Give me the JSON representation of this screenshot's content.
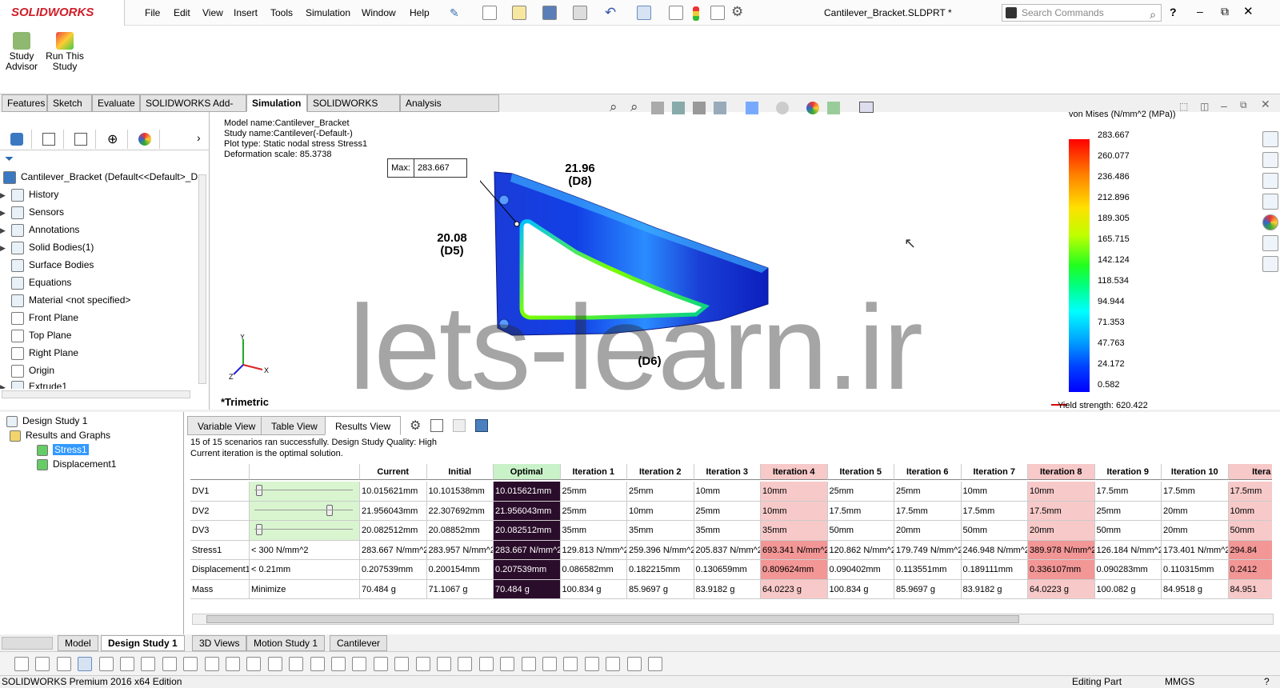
{
  "app": {
    "logo": "SOLIDWORKS",
    "document_title": "Cantilever_Bracket.SLDPRT *"
  },
  "menu": [
    "File",
    "Edit",
    "View",
    "Insert",
    "Tools",
    "Simulation",
    "Window",
    "Help"
  ],
  "search": {
    "placeholder": "Search Commands"
  },
  "command_manager": {
    "study_advisor": "Study Advisor",
    "run_study": "Run This Study"
  },
  "tabs": [
    "Features",
    "Sketch",
    "Evaluate",
    "SOLIDWORKS Add-Ins",
    "Simulation",
    "SOLIDWORKS MBD",
    "Analysis Preparation"
  ],
  "tabs_active": "Simulation",
  "feature_tree": {
    "root": "Cantilever_Bracket  (Default<<Default>_D",
    "items": [
      "History",
      "Sensors",
      "Annotations",
      "Solid Bodies(1)",
      "Surface Bodies",
      "Equations",
      "Material <not specified>",
      "Front Plane",
      "Top Plane",
      "Right Plane",
      "Origin",
      "Extrude1"
    ]
  },
  "plot_info": {
    "model": "Model name:Cantilever_Bracket",
    "study": "Study name:Cantilever(-Default-)",
    "type": "Plot type: Static nodal stress Stress1",
    "scale": "Deformation scale: 85.3738"
  },
  "max_label": {
    "key": "Max:",
    "value": "283.667"
  },
  "dimensions": {
    "d8": "21.96\n(D8)",
    "d5": "20.08\n(D5)",
    "d6": "(D6)"
  },
  "watermark": "lets-learn.ir",
  "view_label": "*Trimetric",
  "legend": {
    "title": "von Mises (N/mm^2 (MPa))",
    "ticks": [
      "283.667",
      "260.077",
      "236.486",
      "212.896",
      "189.305",
      "165.715",
      "142.124",
      "118.534",
      "94.944",
      "71.353",
      "47.763",
      "24.172",
      "0.582"
    ],
    "yield": "Yield strength: 620.422"
  },
  "design_tree": {
    "root": "Design Study 1",
    "group": "Results and Graphs",
    "items": [
      "Stress1",
      "Displacement1"
    ]
  },
  "view_tabs": [
    "Variable View",
    "Table View",
    "Results View"
  ],
  "view_tabs_active": "Results View",
  "ds_message": [
    "15 of 15 scenarios ran successfully. Design Study Quality: High",
    "Current iteration is the optimal solution."
  ],
  "table": {
    "headers": [
      "Current",
      "Initial",
      "Optimal",
      "Iteration 1",
      "Iteration 2",
      "Iteration 3",
      "Iteration 4",
      "Iteration 5",
      "Iteration 6",
      "Iteration 7",
      "Iteration 8",
      "Iteration 9",
      "Iteration 10",
      "Itera"
    ],
    "rows": [
      {
        "name": "DV1",
        "constraint": "",
        "slider": 0.02,
        "values": [
          "10.015621mm",
          "10.101538mm",
          "10.015621mm",
          "25mm",
          "25mm",
          "10mm",
          "10mm",
          "25mm",
          "25mm",
          "10mm",
          "10mm",
          "17.5mm",
          "17.5mm",
          "17.5mm"
        ]
      },
      {
        "name": "DV2",
        "constraint": "",
        "slider": 0.78,
        "values": [
          "21.956043mm",
          "22.307692mm",
          "21.956043mm",
          "25mm",
          "10mm",
          "25mm",
          "10mm",
          "17.5mm",
          "17.5mm",
          "17.5mm",
          "17.5mm",
          "25mm",
          "20mm",
          "10mm"
        ]
      },
      {
        "name": "DV3",
        "constraint": "",
        "slider": 0.02,
        "values": [
          "20.082512mm",
          "20.08852mm",
          "20.082512mm",
          "35mm",
          "35mm",
          "35mm",
          "35mm",
          "50mm",
          "20mm",
          "50mm",
          "20mm",
          "50mm",
          "20mm",
          "50mm"
        ]
      },
      {
        "name": "Stress1",
        "constraint": "< 300 N/mm^2",
        "values": [
          "283.667 N/mm^2",
          "283.957 N/mm^2",
          "283.667 N/mm^2",
          "129.813 N/mm^2",
          "259.396 N/mm^2",
          "205.837 N/mm^2",
          "693.341 N/mm^2",
          "120.862 N/mm^2",
          "179.749 N/mm^2",
          "246.948 N/mm^2",
          "389.978 N/mm^2",
          "126.184 N/mm^2",
          "173.401 N/mm^2",
          "294.84"
        ]
      },
      {
        "name": "Displacement1",
        "constraint": "< 0.21mm",
        "values": [
          "0.207539mm",
          "0.200154mm",
          "0.207539mm",
          "0.086582mm",
          "0.182215mm",
          "0.130659mm",
          "0.809624mm",
          "0.090402mm",
          "0.113551mm",
          "0.189111mm",
          "0.336107mm",
          "0.090283mm",
          "0.110315mm",
          "0.2412"
        ]
      },
      {
        "name": "Mass",
        "constraint": "Minimize",
        "values": [
          "70.484 g",
          "71.1067 g",
          "70.484 g",
          "100.834 g",
          "85.9697 g",
          "83.9182 g",
          "64.0223 g",
          "100.834 g",
          "85.9697 g",
          "83.9182 g",
          "64.0223 g",
          "100.082 g",
          "84.9518 g",
          "84.951"
        ]
      }
    ],
    "failed_columns": [
      "Iteration 4",
      "Iteration 8",
      "Itera"
    ],
    "colors": {
      "optimal": "#2a0d2a",
      "failed": "#f7c9c9",
      "failed_strong": "#f29696",
      "header_optimal": "#c9f2c9"
    }
  },
  "bottom_tabs": [
    "Model",
    "Design Study 1",
    "3D Views",
    "Motion Study 1",
    "Cantilever"
  ],
  "bottom_tabs_active": "Design Study 1",
  "status": {
    "edition": "SOLIDWORKS Premium 2016 x64 Edition",
    "mode": "Editing Part",
    "units": "MMGS"
  }
}
